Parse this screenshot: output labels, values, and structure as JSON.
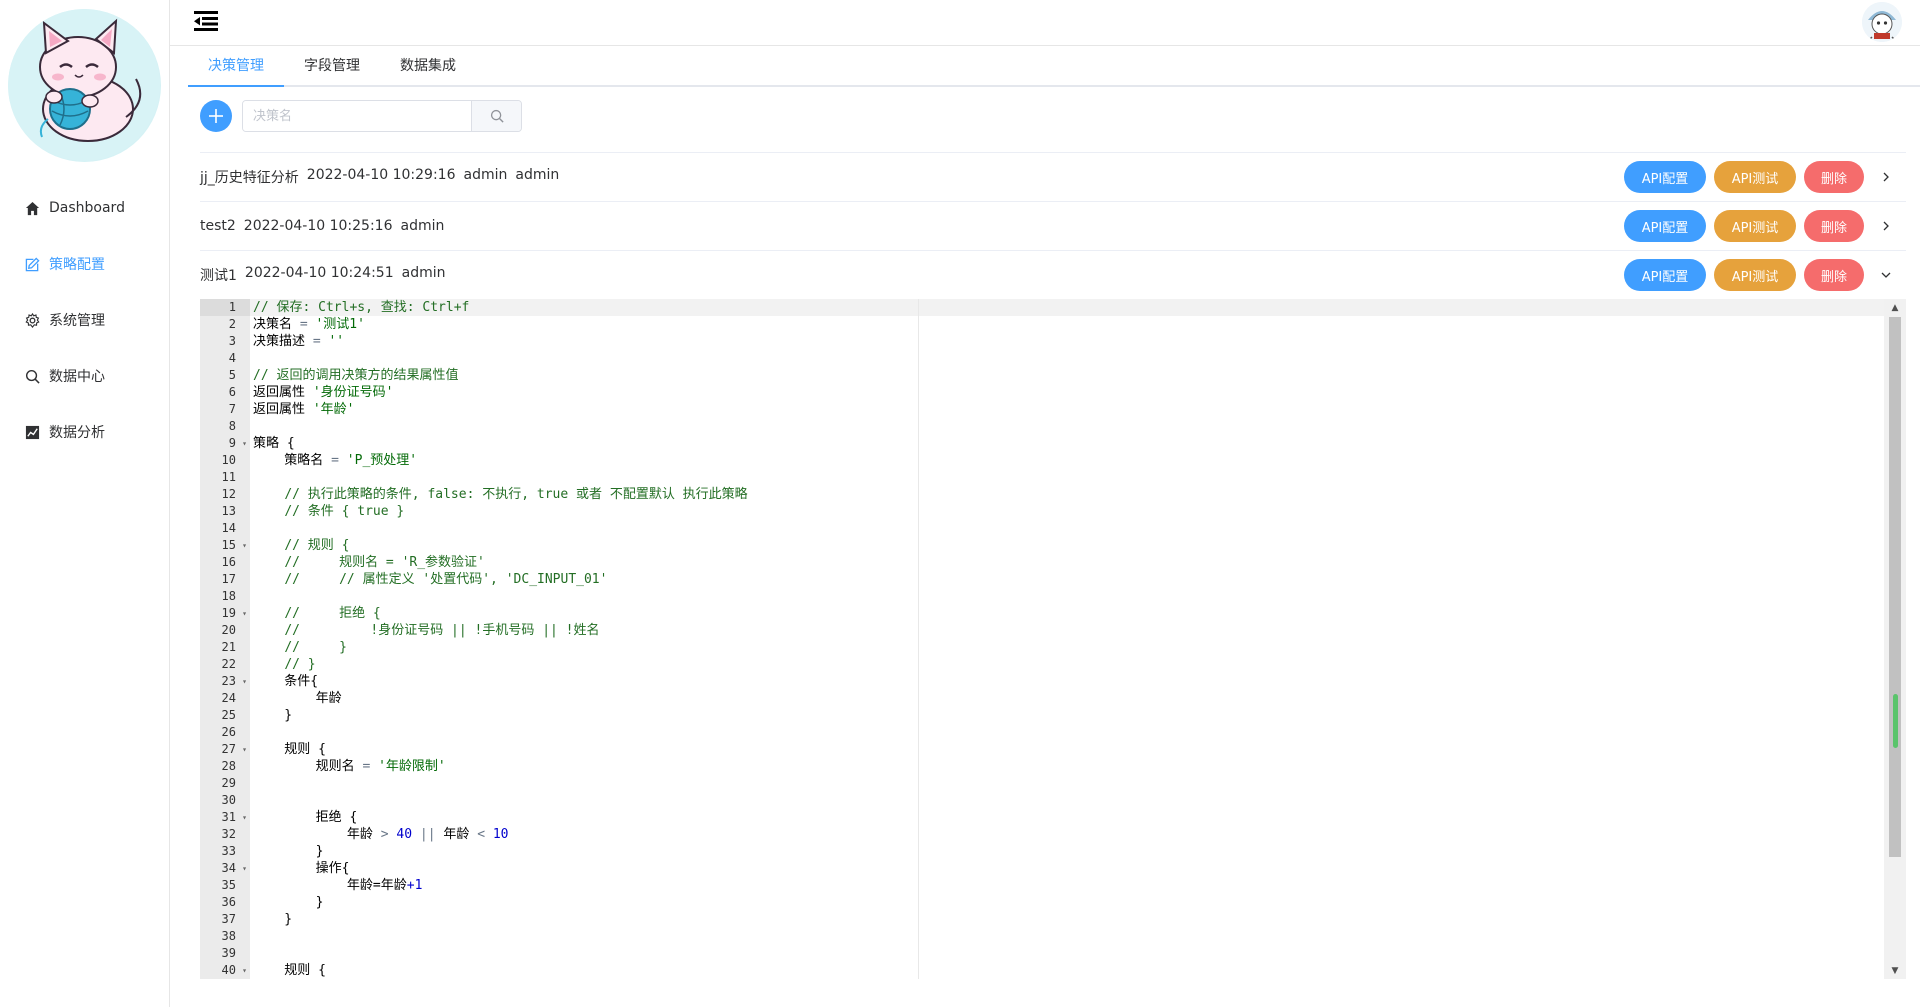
{
  "sidebar": {
    "items": [
      {
        "label": "Dashboard",
        "icon": "home-icon",
        "active": false
      },
      {
        "label": "策略配置",
        "icon": "edit-icon",
        "active": true
      },
      {
        "label": "系统管理",
        "icon": "gear-icon",
        "active": false
      },
      {
        "label": "数据中心",
        "icon": "search-icon",
        "active": false
      },
      {
        "label": "数据分析",
        "icon": "chart-icon",
        "active": false
      }
    ]
  },
  "tabs": [
    {
      "label": "决策管理",
      "active": true
    },
    {
      "label": "字段管理",
      "active": false
    },
    {
      "label": "数据集成",
      "active": false
    }
  ],
  "toolbar": {
    "search_placeholder": "决策名"
  },
  "decisions": [
    {
      "name": "jj_历史特征分析",
      "time": "2022-04-10 10:29:16",
      "creator": "admin",
      "updater": "admin",
      "cfg_label": "API配置",
      "test_label": "API测试",
      "delete_label": "删除",
      "expanded": false
    },
    {
      "name": "test2",
      "time": "2022-04-10 10:25:16",
      "creator": "admin",
      "updater": "",
      "cfg_label": "API配置",
      "test_label": "API测试",
      "delete_label": "删除",
      "expanded": false
    },
    {
      "name": "测试1",
      "time": "2022-04-10 10:24:51",
      "creator": "admin",
      "updater": "",
      "cfg_label": "API配置",
      "test_label": "API测试",
      "delete_label": "删除",
      "expanded": true
    }
  ],
  "editor": {
    "lines": [
      "// 保存: Ctrl+s, 查找: Ctrl+f",
      "决策名 = '测试1'",
      "决策描述 = ''",
      "",
      "// 返回的调用决策方的结果属性值",
      "返回属性 '身份证号码'",
      "返回属性 '年龄'",
      "",
      "策略 {",
      "    策略名 = 'P_预处理'",
      "",
      "    // 执行此策略的条件, false: 不执行, true 或者 不配置默认 执行此策略",
      "    // 条件 { true }",
      "",
      "    // 规则 {",
      "    //     规则名 = 'R_参数验证'",
      "    //     // 属性定义 '处置代码', 'DC_INPUT_01'",
      "",
      "    //     拒绝 {",
      "    //         !身份证号码 || !手机号码 || !姓名",
      "    //     }",
      "    // }",
      "    条件{",
      "        年龄",
      "    }",
      "",
      "    规则 {",
      "        规则名 = '年龄限制'",
      "",
      "",
      "        拒绝 {",
      "            年龄 > 40 || 年龄 < 10",
      "        }",
      "        操作{",
      "            年龄=年龄+1",
      "        }",
      "    }",
      "",
      "",
      "    规则 {"
    ],
    "fold_lines": [
      9,
      15,
      19,
      23,
      27,
      31,
      34,
      40
    ]
  }
}
